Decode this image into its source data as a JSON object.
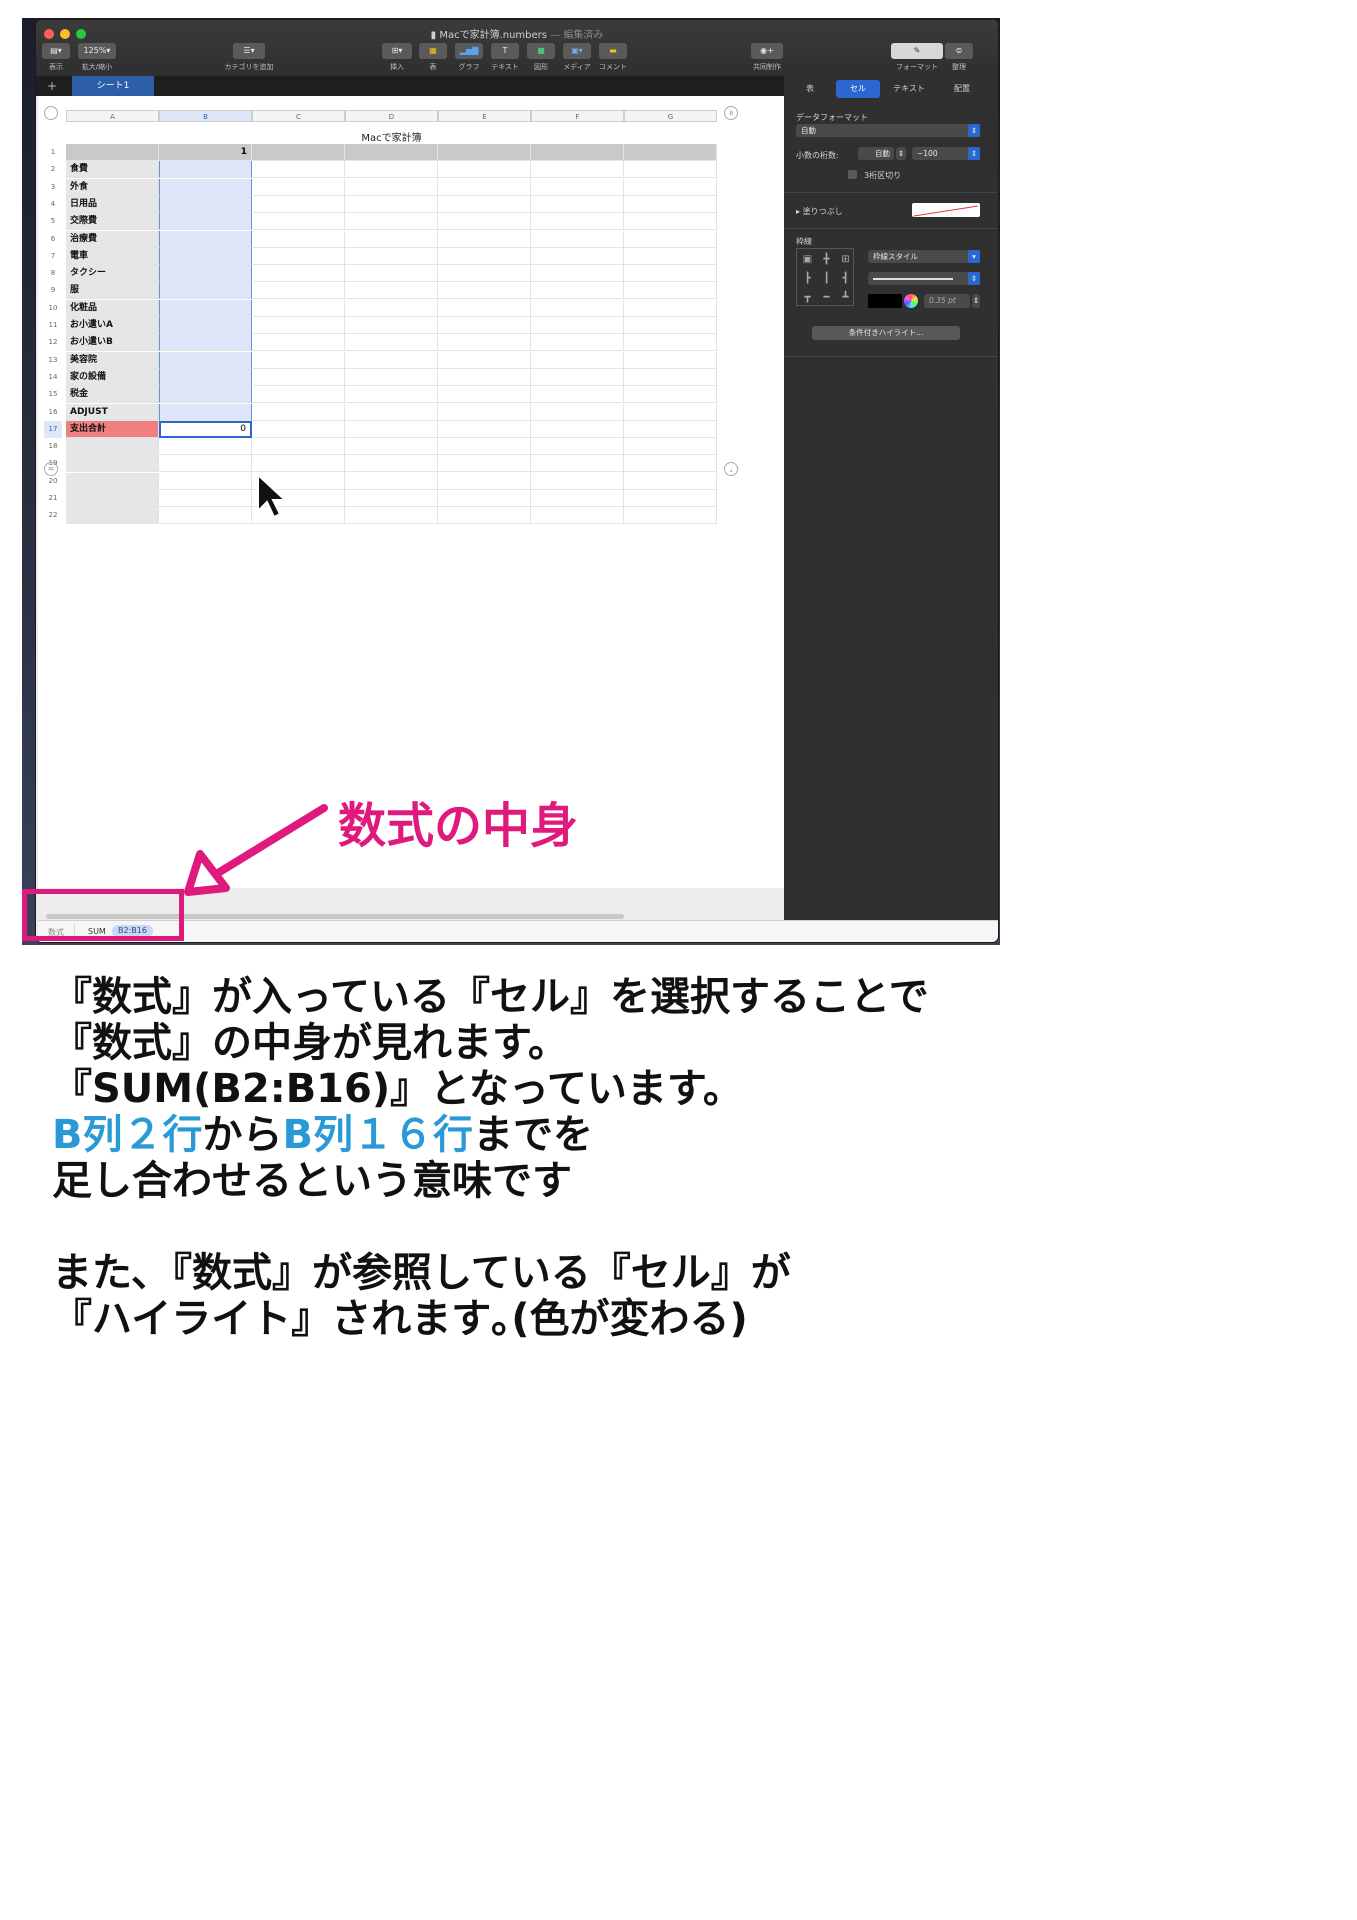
{
  "window": {
    "title": "Macで家計簿.numbers",
    "title_status": "— 編集済み"
  },
  "toolbar": {
    "view_label": "表示",
    "zoom_value": "125%",
    "zoom_label": "拡大/縮小",
    "category_label": "カテゴリを追加",
    "insert_label": "挿入",
    "table_label": "表",
    "chart_label": "グラフ",
    "text_label": "テキスト",
    "shape_label": "図形",
    "media_label": "メディア",
    "comment_label": "コメント",
    "collab_label": "共同制作",
    "format_label": "フォーマット",
    "organize_label": "整理"
  },
  "sheet_tabs": {
    "add": "+",
    "active": "シート1"
  },
  "inspector": {
    "tabs": [
      "表",
      "セル",
      "テキスト",
      "配置"
    ],
    "active_tab": "セル",
    "data_format_label": "データフォーマット",
    "data_format_value": "自動",
    "decimals_label": "小数の桁数:",
    "decimals_value": "自動",
    "negative_value": "−100",
    "thousands_label": "3桁区切り",
    "fill_label": "塗りつぶし",
    "border_label": "枠線",
    "border_style_value": "枠線スタイル",
    "border_width_value": "0.35 pt",
    "conditional_button": "条件付きハイライト..."
  },
  "table": {
    "title": "Macで家計簿",
    "columns": [
      "A",
      "B",
      "C",
      "D",
      "E",
      "F",
      "G"
    ],
    "header_b": "1",
    "row_labels": [
      "食費",
      "外食",
      "日用品",
      "交際費",
      "治療費",
      "電車",
      "タクシー",
      "服",
      "化粧品",
      "お小遣いA",
      "お小遣いB",
      "美容院",
      "家の設備",
      "税金",
      "ADJUST",
      "支出合計"
    ],
    "total_value": "0",
    "row_count": 22
  },
  "formula_bar": {
    "label": "数式",
    "function": "SUM",
    "range": "B2:B16"
  },
  "annotation": {
    "callout": "数式の中身",
    "color": "#e0197d"
  },
  "explanation": {
    "line1": "『数式』が入っている『セル』を選択することで",
    "line2": "『数式』の中身が見れます。",
    "line3": "『SUM(B2:B16)』となっています。",
    "line4_a": "B列２行",
    "line4_b": "から",
    "line4_c": "B列１６行",
    "line4_d": "までを",
    "line5": "足し合わせるという意味です",
    "line6": "また､『数式』が参照している『セル』が",
    "line7": "『ハイライト』されます｡(色が変わる)"
  },
  "colors": {
    "accent": "#2a9ad6",
    "selection": "#dfe6fa",
    "total_row": "#f08080"
  }
}
